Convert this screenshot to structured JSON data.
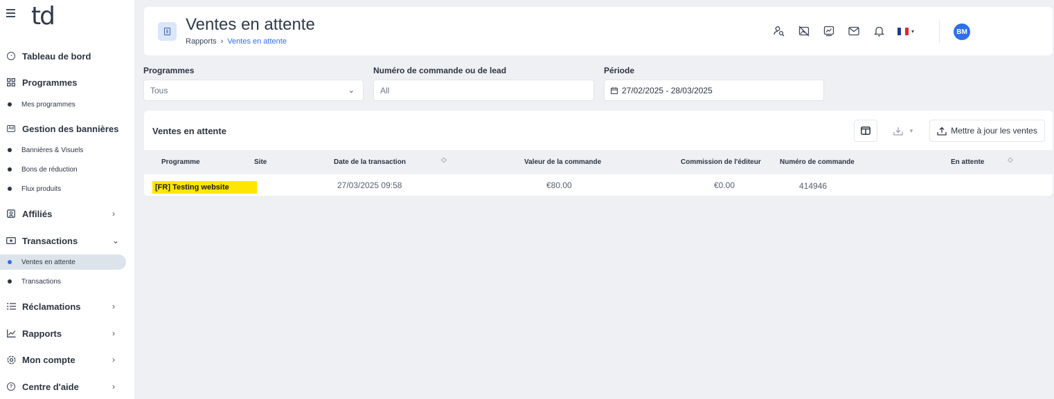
{
  "sidebar": {
    "logo": "td",
    "items": [
      {
        "label": "Tableau de bord"
      },
      {
        "label": "Programmes"
      },
      {
        "label": "Gestion des bannières"
      },
      {
        "label": "Affiliés"
      },
      {
        "label": "Transactions"
      },
      {
        "label": "Réclamations"
      },
      {
        "label": "Rapports"
      },
      {
        "label": "Mon compte"
      },
      {
        "label": "Centre d'aide"
      }
    ],
    "subitems": [
      {
        "label": "Mes programmes"
      },
      {
        "label": "Bannières & Visuels"
      },
      {
        "label": "Bons de réduction"
      },
      {
        "label": "Flux produits"
      },
      {
        "label": "Ventes en attente"
      },
      {
        "label": "Transactions"
      }
    ],
    "banner_icon_text": "Ad"
  },
  "header": {
    "title": "Ventes en attente",
    "breadcrumb": {
      "root": "Rapports",
      "separator": "›",
      "current": "Ventes en attente"
    },
    "avatar_initials": "BM",
    "icons": [
      "user-search-icon",
      "no-image-icon",
      "chart-message-icon",
      "mail-icon",
      "bell-icon",
      "france-flag-icon"
    ]
  },
  "filters": {
    "programmes": {
      "label": "Programmes",
      "value": "Tous"
    },
    "order": {
      "label": "Numéro de commande ou de lead",
      "value": "All"
    },
    "period": {
      "label": "Période",
      "value": "27/02/2025 - 28/03/2025"
    }
  },
  "table": {
    "title": "Ventes en attente",
    "update_button": "Mettre à jour les ventes",
    "columns": [
      "Programme",
      "Site",
      "Date de la transaction",
      "Valeur de la commande",
      "Commission de l'éditeur",
      "Numéro de commande",
      "En attente"
    ],
    "rows": [
      {
        "programme": "[FR] Testing website",
        "site": "",
        "date": "27/03/2025 09:58",
        "value": "€80.00",
        "commission": "€0.00",
        "order": "414946",
        "pending": ""
      }
    ]
  },
  "colors": {
    "accent": "#2d6ff0",
    "highlight": "#ffe600",
    "background": "#eef0f3"
  }
}
